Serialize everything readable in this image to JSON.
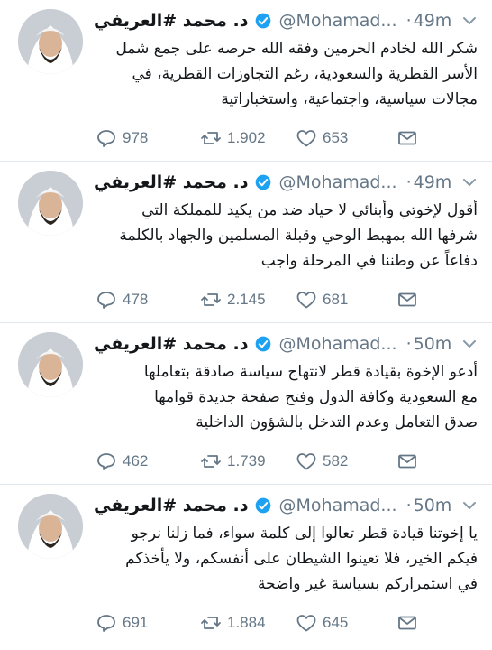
{
  "colors": {
    "accent": "#1da1f2",
    "muted": "#657786",
    "text": "#14171a",
    "divider": "#e1e8ed"
  },
  "icons": {
    "verified": "verified-badge-icon",
    "caret": "chevron-down-icon",
    "reply": "reply-icon",
    "retweet": "retweet-icon",
    "like": "heart-icon",
    "dm": "envelope-icon"
  },
  "tweets": [
    {
      "name": "د. محمد #العريفي",
      "handle": "@Mohamad...",
      "separator": "·",
      "time": "49m",
      "lines": [
        "شكر الله لخادم الحرمين وفقه الله حرصه على جمع شمل",
        "الأسر القطرية والسعودية، رغم التجاوزات القطرية، في",
        "مجالات سياسية، واجتماعية، واستخباراتية"
      ],
      "replies": "978",
      "retweets": "1.902",
      "likes": "653"
    },
    {
      "name": "د. محمد #العريفي",
      "handle": "@Mohamad...",
      "separator": "·",
      "time": "49m",
      "lines": [
        "أقول لإخوتي وأبنائي لا حياد ضد من يكيد للمملكة التي",
        "شرفها الله بمهبط الوحي وقبلة المسلمين والجهاد بالكلمة",
        "دفاعاً عن وطننا في المرحلة واجب"
      ],
      "replies": "478",
      "retweets": "2.145",
      "likes": "681"
    },
    {
      "name": "د. محمد #العريفي",
      "handle": "@Mohamad...",
      "separator": "·",
      "time": "50m",
      "lines": [
        "أدعو الإخوة بقيادة قطر لانتهاج سياسة صادقة بتعاملها",
        "مع السعودية وكافة الدول وفتح صفحة جديدة قوامها",
        "صدق التعامل وعدم التدخل بالشؤون الداخلية"
      ],
      "replies": "462",
      "retweets": "1.739",
      "likes": "582"
    },
    {
      "name": "د. محمد #العريفي",
      "handle": "@Mohamad...",
      "separator": "·",
      "time": "50m",
      "lines": [
        "يا إخوتنا قيادة قطر تعالوا إلى كلمة سواء، فما زلنا نرجو",
        "فيكم الخير، فلا تعينوا الشيطان على أنفسكم، ولا يأخذكم",
        "في استمراركم بسياسة غير واضحة"
      ],
      "replies": "691",
      "retweets": "1.884",
      "likes": "645"
    }
  ]
}
